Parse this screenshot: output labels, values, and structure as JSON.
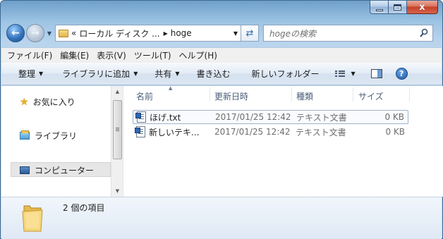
{
  "window": {
    "close_label": "x"
  },
  "address": {
    "overflow": "«",
    "segments": [
      "ローカル ディスク ...",
      "hoge"
    ]
  },
  "search": {
    "placeholder": "hogeの検索"
  },
  "menu": {
    "items": [
      "ファイル(F)",
      "編集(E)",
      "表示(V)",
      "ツール(T)",
      "ヘルプ(H)"
    ]
  },
  "commands": {
    "organize": "整理",
    "add_to_library": "ライブラリに追加",
    "share": "共有",
    "burn": "書き込む",
    "new_folder": "新しいフォルダー",
    "help": "?"
  },
  "navpane": {
    "favorites": "お気に入り",
    "libraries": "ライブラリ",
    "computer": "コンピューター"
  },
  "filelist": {
    "columns": [
      "名前",
      "更新日時",
      "種類",
      "サイズ"
    ],
    "files": [
      {
        "name": "ほげ.txt",
        "date": "2017/01/25 12:42",
        "type": "テキスト文書",
        "size": "0 KB"
      },
      {
        "name": "新しいテキ...",
        "date": "2017/01/25 12:42",
        "type": "テキスト文書",
        "size": "0 KB"
      }
    ]
  },
  "details": {
    "item_count": "2 個の項目"
  },
  "icons": [
    "back-arrow-icon",
    "forward-arrow-icon",
    "folder-icon",
    "refresh-icon",
    "search-icon",
    "star-icon",
    "library-icon",
    "computer-icon",
    "text-file-icon",
    "view-icon",
    "preview-pane-icon",
    "help-icon"
  ]
}
